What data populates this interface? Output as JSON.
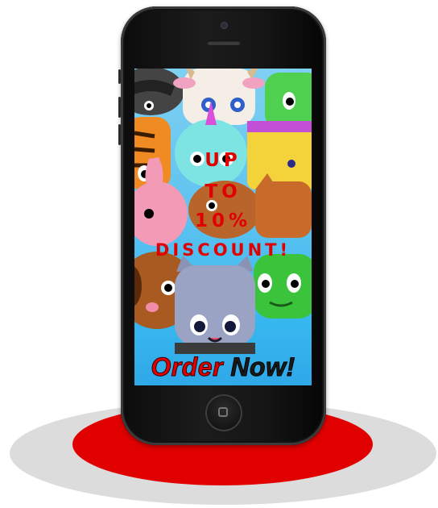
{
  "promo": {
    "line1": "UP",
    "line2": "TO",
    "line3": "10%",
    "line4": "DISCOUNT!"
  },
  "cta": {
    "word1": "Order",
    "word2": "Now!"
  },
  "colors": {
    "accent_red": "#e00000",
    "platform_red": "#e10000",
    "phone_body": "#111111",
    "sky": "#5fc3f0"
  },
  "icons": {
    "home": "home-button-icon",
    "camera": "front-camera-icon",
    "speaker": "earpiece-speaker-icon"
  }
}
